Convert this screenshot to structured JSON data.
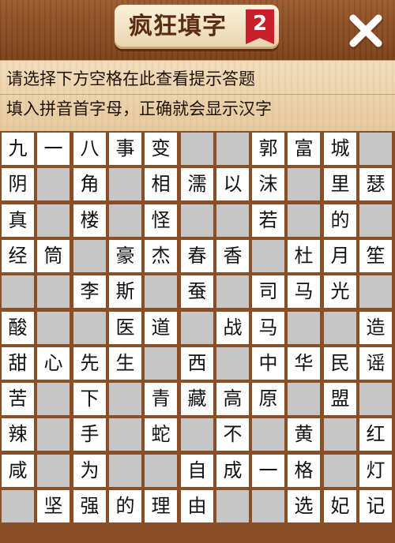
{
  "app": {
    "title": "疯狂填字",
    "level_badge": "2",
    "close_icon": "close-icon"
  },
  "hints": {
    "line1": "请选择下方空格在此查看提示答题",
    "line2": "填入拼音首字母，正确就会显示汉字"
  },
  "colors": {
    "wood": "#8b4f26",
    "panel": "#f2ddbc",
    "cell_filled": "#ffffff",
    "cell_blank": "#c6c6c6",
    "badge": "#c8202a"
  },
  "grid": {
    "rows": [
      [
        "九",
        "一",
        "八",
        "事",
        "变",
        "",
        "",
        "郭",
        "富",
        "城",
        ""
      ],
      [
        "阴",
        "",
        "角",
        "",
        "相",
        "濡",
        "以",
        "沫",
        "",
        "里",
        "瑟"
      ],
      [
        "真",
        "",
        "楼",
        "",
        "怪",
        "",
        "",
        "若",
        "",
        "的",
        ""
      ],
      [
        "经",
        "筒",
        "",
        "豪",
        "杰",
        "春",
        "香",
        "",
        "杜",
        "月",
        "笙"
      ],
      [
        "",
        "",
        "李",
        "斯",
        "",
        "蚕",
        "",
        "司",
        "马",
        "光",
        ""
      ],
      [
        "酸",
        "",
        "",
        "医",
        "道",
        "",
        "战",
        "马",
        "",
        "",
        "造"
      ],
      [
        "甜",
        "心",
        "先",
        "生",
        "",
        "西",
        "",
        "中",
        "华",
        "民",
        "谣"
      ],
      [
        "苦",
        "",
        "下",
        "",
        "青",
        "藏",
        "高",
        "原",
        "",
        "盟",
        ""
      ],
      [
        "辣",
        "",
        "手",
        "",
        "蛇",
        "",
        "不",
        "",
        "黄",
        "",
        "红"
      ],
      [
        "咸",
        "",
        "为",
        "",
        "",
        "自",
        "成",
        "一",
        "格",
        "",
        "灯"
      ],
      [
        "",
        "坚",
        "强",
        "的",
        "理",
        "由",
        "",
        "",
        "选",
        "妃",
        "记"
      ]
    ]
  }
}
